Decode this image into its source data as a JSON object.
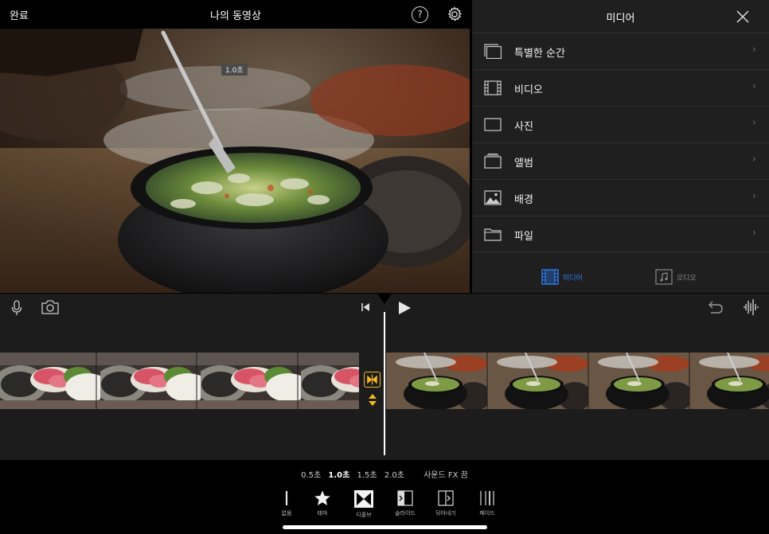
{
  "topbar": {
    "done_label": "완료",
    "title": "나의 동영상",
    "help_label": "?"
  },
  "preview": {
    "duration_badge": "1.0초"
  },
  "media_panel": {
    "title": "미디어",
    "items": [
      {
        "label": "특별한 순간",
        "icon": "moments-icon"
      },
      {
        "label": "비디오",
        "icon": "film-icon"
      },
      {
        "label": "사진",
        "icon": "photo-icon"
      },
      {
        "label": "앨범",
        "icon": "album-icon"
      },
      {
        "label": "배경",
        "icon": "background-icon"
      },
      {
        "label": "파일",
        "icon": "folder-icon"
      }
    ],
    "chevron": "›",
    "tabs": {
      "media_label": "미디어",
      "audio_label": "오디오"
    }
  },
  "transition_bar": {
    "durations": [
      "0.5초",
      "1.0초",
      "1.5초",
      "2.0초"
    ],
    "selected_duration": "1.0초",
    "sound_fx": "사운드 FX 끔",
    "options": [
      {
        "label": "없음",
        "icon": "none-transition-icon"
      },
      {
        "label": "테마",
        "icon": "star-icon"
      },
      {
        "label": "디졸브",
        "icon": "dissolve-icon"
      },
      {
        "label": "슬라이드",
        "icon": "slide-icon"
      },
      {
        "label": "닦아내기",
        "icon": "wipe-icon"
      },
      {
        "label": "페이드",
        "icon": "fade-icon"
      }
    ]
  },
  "colors": {
    "accent_blue": "#2f7ef5",
    "transition_yellow": "#f2b81c",
    "panel_bg": "#1f1f1f",
    "timeline_bg": "#1c1c1c"
  }
}
